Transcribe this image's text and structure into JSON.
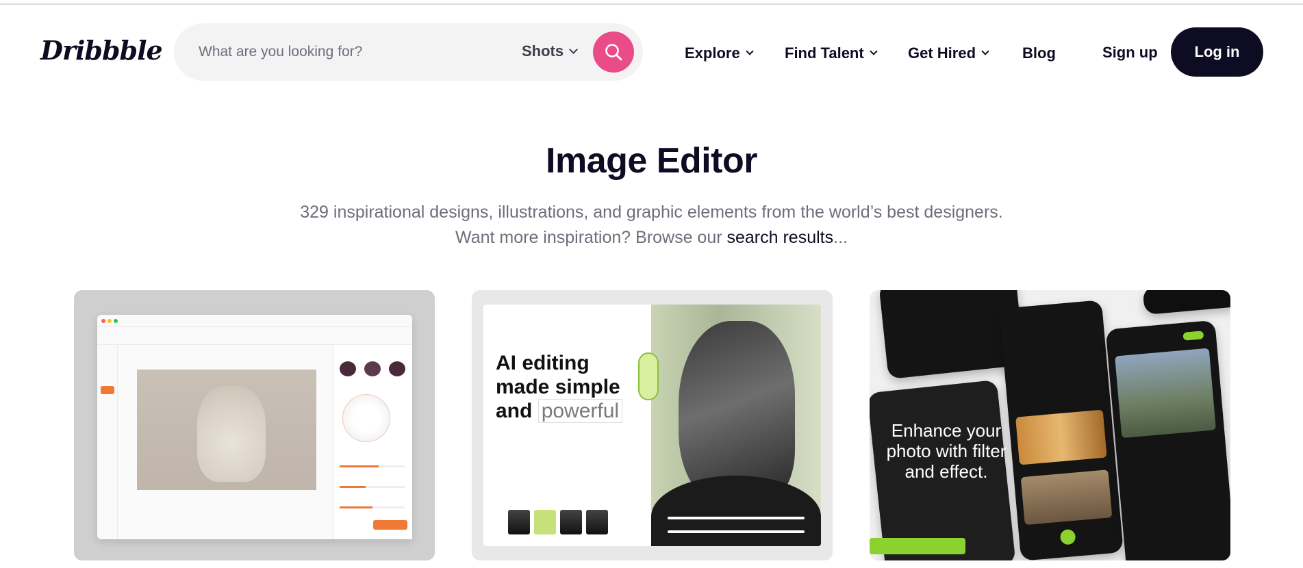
{
  "brand": {
    "name": "Dribbble"
  },
  "search": {
    "placeholder": "What are you looking for?",
    "category": "Shots"
  },
  "nav": {
    "items": [
      {
        "label": "Explore",
        "has_dropdown": true
      },
      {
        "label": "Find Talent",
        "has_dropdown": true
      },
      {
        "label": "Get Hired",
        "has_dropdown": true
      },
      {
        "label": "Blog",
        "has_dropdown": false
      }
    ],
    "signup": "Sign up",
    "login": "Log in"
  },
  "hero": {
    "title": "Image Editor",
    "subtitle_line1": "329 inspirational designs, illustrations, and graphic elements from the world’s best designers.",
    "subtitle_line2_prefix": "Want more inspiration? Browse our ",
    "subtitle_link": "search results",
    "subtitle_suffix": "..."
  },
  "shots": [
    {
      "kind": "image-editor-app-mockup"
    },
    {
      "kind": "ai-editing-landing-page",
      "headline_lines": [
        "AI editing",
        "made simple",
        "and"
      ],
      "headline_highlight": "powerful"
    },
    {
      "kind": "mobile-photo-app-screens",
      "tagline": "Enhance your photo with filter and effect."
    }
  ],
  "colors": {
    "accent_pink": "#ea4c89",
    "dark": "#0d0c22",
    "muted_text": "#6e6d7a",
    "search_bg": "#f3f3f4"
  },
  "icons": {
    "search": "search-icon",
    "dropdown": "chevron-down-icon"
  }
}
